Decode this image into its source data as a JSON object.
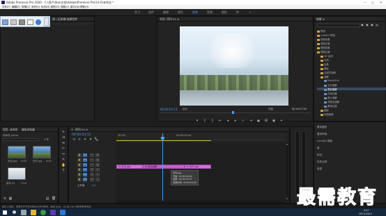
{
  "window": {
    "title": "Adobe Premiere Pro 2020 - C:\\用户\\Sho\\文档\\Adobe\\Premiere Pro\\14.0\\未命名 *",
    "minimize": "—",
    "maximize": "□",
    "close": "✕"
  },
  "menu": [
    "文件(F)",
    "编辑(E)",
    "剪辑(C)",
    "序列(S)",
    "标记(M)",
    "图形(G)",
    "视图(V)",
    "窗口(W)",
    "帮助(H)"
  ],
  "workspaces": [
    "学习",
    "组件",
    "编辑",
    "颜色",
    "效果",
    "音频",
    "图形",
    "库",
    "»"
  ],
  "active_workspace": "效果",
  "source_panel": {
    "tabs": [
      "源: (无剪辑)",
      "效果控件",
      "音频剪辑混合器: 序列",
      "元数据"
    ]
  },
  "program_monitor": {
    "title": "节目: 序列 01 ≡",
    "timecode_current": "00:00:03:11",
    "fit_label": "适合",
    "quality_label": "完整",
    "timecode_duration": "00:00:07:05"
  },
  "effects_panel": {
    "title": "效果 ≡",
    "search_placeholder": "",
    "items": [
      {
        "label": "预设",
        "depth": 0,
        "type": "folder"
      },
      {
        "label": "Lumetri 预设",
        "depth": 0,
        "type": "folder"
      },
      {
        "label": "音频效果",
        "depth": 0,
        "type": "folder"
      },
      {
        "label": "音频过渡",
        "depth": 0,
        "type": "folder"
      },
      {
        "label": "视频效果",
        "depth": 0,
        "type": "folder"
      },
      {
        "label": "视频过渡",
        "depth": 0,
        "type": "folder"
      },
      {
        "label": "3D 运动",
        "depth": 1,
        "type": "folder"
      },
      {
        "label": "内滑",
        "depth": 1,
        "type": "folder"
      },
      {
        "label": "划像",
        "depth": 1,
        "type": "folder"
      },
      {
        "label": "擦除",
        "depth": 1,
        "type": "folder"
      },
      {
        "label": "沉浸式视频",
        "depth": 1,
        "type": "folder"
      },
      {
        "label": "溶解",
        "depth": 1,
        "type": "folder"
      },
      {
        "label": "MorphCut",
        "depth": 2,
        "type": "item"
      },
      {
        "label": "交叉溶解",
        "depth": 2,
        "type": "item"
      },
      {
        "label": "叠加溶解",
        "depth": 2,
        "type": "item",
        "selected": true
      },
      {
        "label": "白场过渡",
        "depth": 2,
        "type": "item"
      },
      {
        "label": "胶片溶解",
        "depth": 2,
        "type": "item"
      },
      {
        "label": "非叠加溶解",
        "depth": 2,
        "type": "item"
      },
      {
        "label": "黑场过渡",
        "depth": 2,
        "type": "item"
      },
      {
        "label": "缩放",
        "depth": 1,
        "type": "folder"
      },
      {
        "label": "页面剥落",
        "depth": 1,
        "type": "folder"
      }
    ]
  },
  "right_lower_panel": {
    "items": [
      "基本图形",
      "基本声音",
      "Lumetri 颜色",
      "库",
      "标记",
      "历史记录",
      "信息"
    ]
  },
  "project_panel": {
    "tabs": [
      "项目: 未命名",
      "媒体浏览器"
    ],
    "file_label": "未命名.prproj",
    "count": "3 项",
    "clips": [
      {
        "name": "天空.jpg",
        "duration": "5:00"
      },
      {
        "name": "光芒.jpg",
        "duration": "5:00"
      },
      {
        "name": "序列 01",
        "duration": "7:05"
      }
    ]
  },
  "timeline": {
    "title": "序列 01 ≡",
    "timecode": "00:00:03:11",
    "ruler": [
      ":00:00",
      "00:00:05:00"
    ],
    "tracks": [
      {
        "name": "V3"
      },
      {
        "name": "V2"
      },
      {
        "name": "V1"
      },
      {
        "name": "A1"
      },
      {
        "name": "A2"
      },
      {
        "name": "A3"
      }
    ],
    "master_label": "主声道",
    "master_value": "0.0",
    "clips": [
      {
        "label": "fx 天空.jpg"
      },
      {
        "label": "fx 叠加溶解"
      },
      {
        "label": "fx 光芒.jpg"
      }
    ],
    "tooltip": [
      "序列.jpg",
      "开始: 00:00:00:00",
      "结束: 00:00:03:21",
      "持续时间: 00:00:04:00"
    ]
  },
  "status_bar": "单击以选择，或单击空白处并拖动以进行框选。使用 Shift、Alt 和 Ctrl 可获得其他选项。",
  "taskbar": {
    "time": "9:47",
    "date": "2021/10/15"
  },
  "watermark": "最需教育",
  "colors": {
    "accent": "#4b9cf5",
    "clip": "#d070d8",
    "playhead": "#4b9cf5",
    "background": "#1e1e1e"
  }
}
